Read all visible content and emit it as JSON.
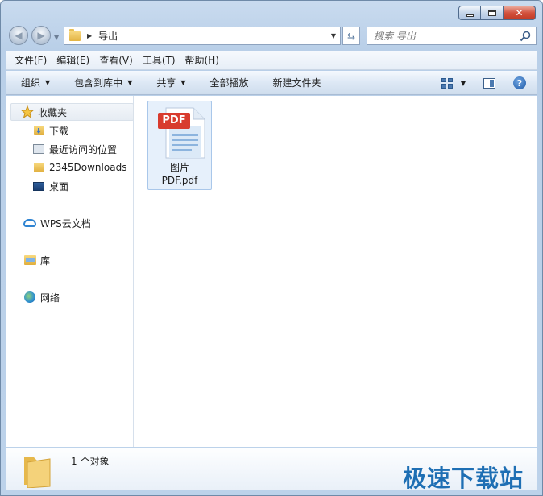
{
  "address": {
    "path_segment": "导出"
  },
  "search": {
    "placeholder": "搜索 导出"
  },
  "menubar": [
    "文件(F)",
    "编辑(E)",
    "查看(V)",
    "工具(T)",
    "帮助(H)"
  ],
  "toolbar": {
    "organize": "组织",
    "include_in_library": "包含到库中",
    "share": "共享",
    "play_all": "全部播放",
    "new_folder": "新建文件夹"
  },
  "nav": {
    "favorites": "收藏夹",
    "downloads": "下载",
    "recent": "最近访问的位置",
    "downloads2345": "2345Downloads",
    "desktop": "桌面",
    "wps_cloud": "WPS云文档",
    "libraries": "库",
    "network": "网络"
  },
  "files": [
    {
      "name_line1": "图片",
      "name_line2": "PDF.pdf",
      "badge": "PDF"
    }
  ],
  "status": {
    "count_text": "1 个对象"
  },
  "watermark": "极速下载站",
  "colors": {
    "pdf_badge": "#d83b2e",
    "accent": "#1e6fb4"
  }
}
